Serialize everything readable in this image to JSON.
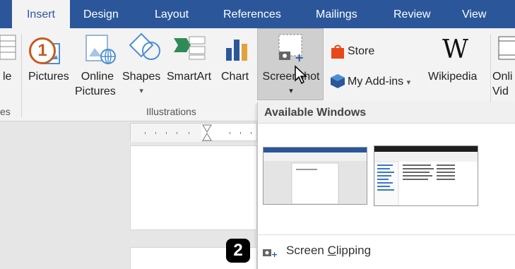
{
  "tabs": [
    {
      "label": "Insert",
      "active": true
    },
    {
      "label": "Design"
    },
    {
      "label": "Layout"
    },
    {
      "label": "References"
    },
    {
      "label": "Mailings"
    },
    {
      "label": "Review"
    },
    {
      "label": "View"
    }
  ],
  "ribbon": {
    "partial_left_label": "le",
    "partial_left_group": "es",
    "pictures": "Pictures",
    "online_pictures_line1": "Online",
    "online_pictures_line2": "Pictures",
    "shapes": "Shapes",
    "smartart": "SmartArt",
    "chart": "Chart",
    "screenshot": "Screenshot",
    "store": "Store",
    "my_addins": "My Add-ins",
    "wikipedia": "Wikipedia",
    "online_video_line1": "Onli",
    "online_video_line2": "Vid",
    "group_illustrations": "Illustrations"
  },
  "dropdown": {
    "header": "Available Windows",
    "clip_prefix": "Screen ",
    "clip_underlined": "C",
    "clip_suffix": "lipping"
  },
  "badges": {
    "step1": "1",
    "step2": "2"
  },
  "colors": {
    "tabbar": "#2b579a",
    "ribbon": "#f3f3f3",
    "badge1_ring": "#c75a1d",
    "store_red": "#e8461b",
    "addin_blue": "#2b579a"
  }
}
